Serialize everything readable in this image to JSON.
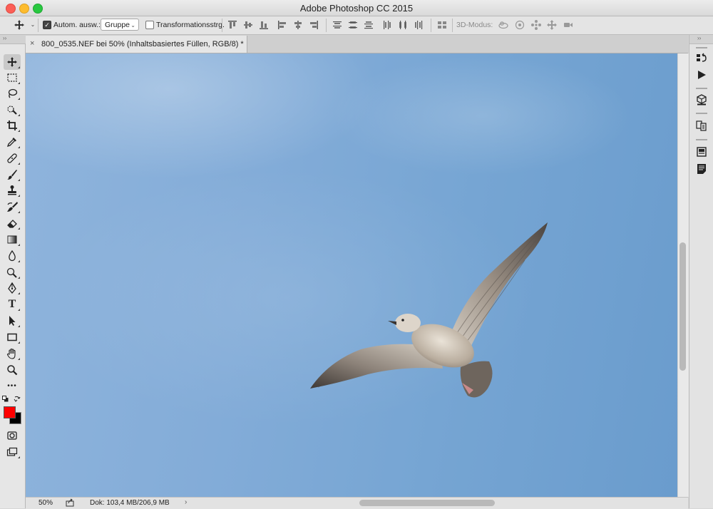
{
  "window": {
    "title": "Adobe Photoshop CC 2015"
  },
  "options_bar": {
    "auto_select_label": "Autom. ausw.:",
    "auto_select_checked": true,
    "auto_select_target": "Gruppe",
    "transform_controls_label": "Transformationsstrg.",
    "transform_controls_checked": false,
    "mode_3d_label": "3D-Modus:"
  },
  "document": {
    "tab_title": "800_0535.NEF bei 50% (Inhaltsbasiertes Füllen, RGB/8) *",
    "tab_close": "×"
  },
  "status_bar": {
    "zoom": "50%",
    "doc_info": "Dok: 103,4 MB/206,9 MB",
    "more_arrow": "›"
  },
  "colors": {
    "foreground": "#ff0000",
    "background": "#000000",
    "close_light": "#fc5f57",
    "minimize_light": "#fdbc2e",
    "zoom_light": "#28c840"
  },
  "tools": [
    "move-tool",
    "marquee-tool",
    "lasso-tool",
    "quick-selection-tool",
    "crop-tool",
    "eyedropper-tool",
    "healing-brush-tool",
    "brush-tool",
    "clone-stamp-tool",
    "history-brush-tool",
    "eraser-tool",
    "gradient-tool",
    "blur-tool",
    "dodge-tool",
    "pen-tool",
    "type-tool",
    "path-selection-tool",
    "rectangle-tool",
    "hand-tool",
    "zoom-tool",
    "more-tools"
  ],
  "type_tool_glyph": "T",
  "more_tools_glyph": "•••",
  "panel_collapse_glyph": "››"
}
